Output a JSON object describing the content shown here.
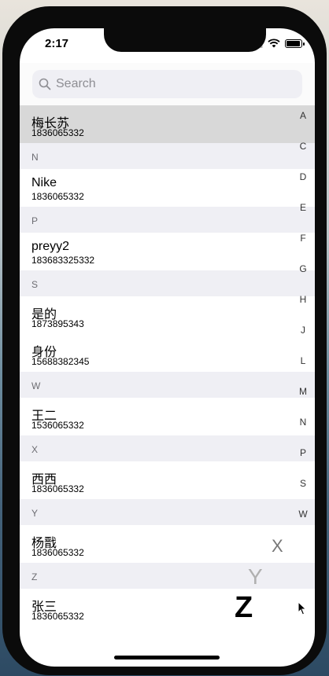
{
  "status": {
    "time": "2:17"
  },
  "search": {
    "placeholder": "Search"
  },
  "sections": [
    {
      "letter": "",
      "contacts": [
        {
          "name": "梅长苏",
          "phone": "1836065332"
        }
      ]
    },
    {
      "letter": "N",
      "contacts": [
        {
          "name": "Nike",
          "phone": "1836065332"
        }
      ]
    },
    {
      "letter": "P",
      "contacts": [
        {
          "name": "preyy2",
          "phone": "183683325332"
        }
      ]
    },
    {
      "letter": "S",
      "contacts": [
        {
          "name": "是的",
          "phone": "1873895343"
        },
        {
          "name": "身份",
          "phone": "15688382345"
        }
      ]
    },
    {
      "letter": "W",
      "contacts": [
        {
          "name": "王二",
          "phone": "1536065332"
        }
      ]
    },
    {
      "letter": "X",
      "contacts": [
        {
          "name": "西西",
          "phone": "1836065332"
        }
      ]
    },
    {
      "letter": "Y",
      "contacts": [
        {
          "name": "杨戬",
          "phone": "1836065332"
        }
      ]
    },
    {
      "letter": "Z",
      "contacts": [
        {
          "name": "张三",
          "phone": "1836065332"
        }
      ]
    }
  ],
  "index_letters": [
    "A",
    "C",
    "D",
    "E",
    "F",
    "G",
    "H",
    "J",
    "L",
    "M",
    "N",
    "P",
    "S",
    "W"
  ],
  "scroll_overlay": {
    "x": "X",
    "y": "Y",
    "z": "Z"
  }
}
